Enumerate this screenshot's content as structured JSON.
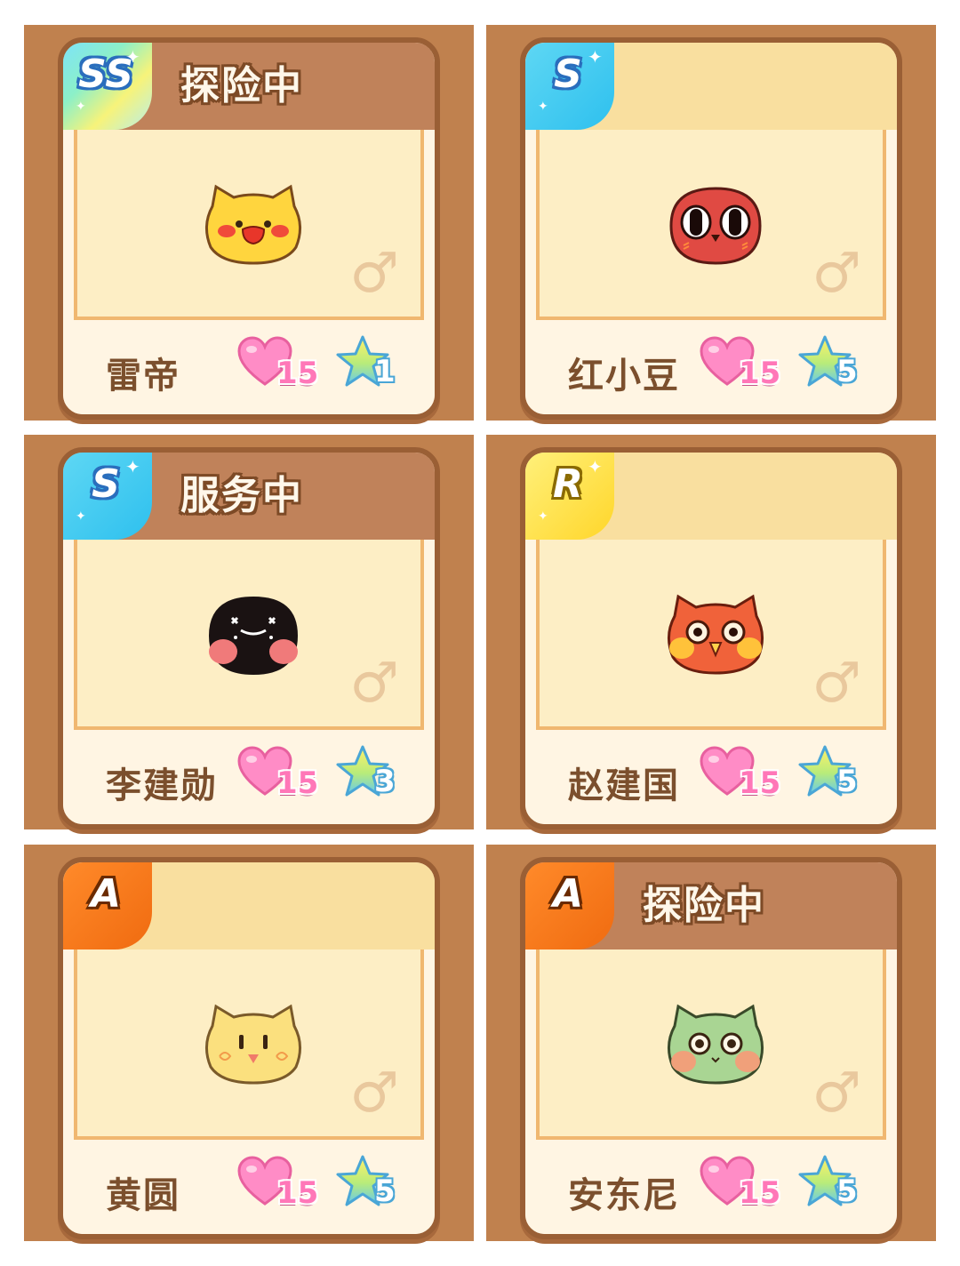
{
  "pets": [
    {
      "rank": "SS",
      "status": "探险中",
      "name": "雷帝",
      "gender": "♂",
      "hearts": "15",
      "stars": "1",
      "color": "#ffd53e"
    },
    {
      "rank": "S",
      "status": "",
      "name": "红小豆",
      "gender": "♂",
      "hearts": "15",
      "stars": "5",
      "color": "#e04a43"
    },
    {
      "rank": "S",
      "status": "服务中",
      "name": "李建勋",
      "gender": "♂",
      "hearts": "15",
      "stars": "3",
      "color": "#1a1212"
    },
    {
      "rank": "R",
      "status": "",
      "name": "赵建国",
      "gender": "♂",
      "hearts": "15",
      "stars": "5",
      "color": "#f0623a"
    },
    {
      "rank": "A",
      "status": "",
      "name": "黄圆",
      "gender": "♂",
      "hearts": "15",
      "stars": "5",
      "color": "#fbe07e"
    },
    {
      "rank": "A",
      "status": "探险中",
      "name": "安东尼",
      "gender": "♂",
      "hearts": "15",
      "stars": "5",
      "color": "#a9d593"
    }
  ]
}
